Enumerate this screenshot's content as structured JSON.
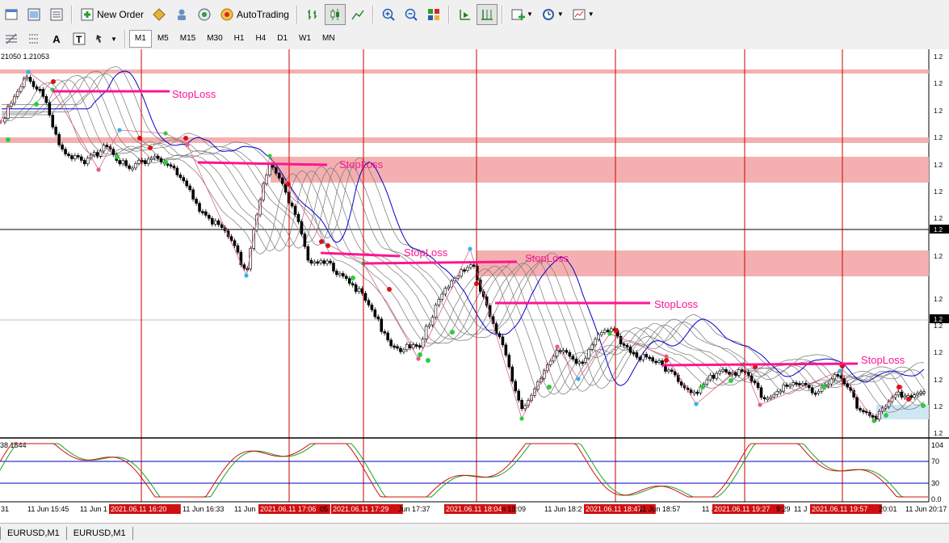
{
  "toolbar": {
    "new_order": "New Order",
    "autotrading": "AutoTrading"
  },
  "timeframes": [
    "M1",
    "M5",
    "M15",
    "M30",
    "H1",
    "H4",
    "D1",
    "W1",
    "MN"
  ],
  "active_timeframe": "M1",
  "chart": {
    "price_header": "21050 1.21053",
    "indicator_header": "38.1544",
    "right_labels": [
      "1.2",
      "1.2",
      "1.2",
      "1.2",
      "1.2",
      "1.2",
      "1.2",
      "1.2",
      "1.2",
      "1.2",
      "1.2",
      "1.2",
      "1.2",
      "1.2",
      "1.2"
    ],
    "current_price_label": "1.2",
    "indicator_levels": [
      "104",
      "70",
      "30",
      "0.0"
    ],
    "stoploss_label": "StopLoss",
    "time_axis": [
      {
        "text": "31",
        "highlight": false
      },
      {
        "text": "11 Jun 15:45",
        "highlight": false
      },
      {
        "text": "11 Jun 1",
        "highlight": false
      },
      {
        "text": "2021.06.11 16:20",
        "highlight": true
      },
      {
        "text": "11 Jun 16:33",
        "highlight": false
      },
      {
        "text": "11 Jun",
        "highlight": false
      },
      {
        "text": "2021.06.11 17:06",
        "highlight": true
      },
      {
        "text": "05",
        "highlight": false
      },
      {
        "text": "2021.06.11 17:29",
        "highlight": true
      },
      {
        "text": "Jun 17:37",
        "highlight": false
      },
      {
        "text": "2021.06.11 18:04",
        "highlight": true
      },
      {
        "text": "n 18:09",
        "highlight": false
      },
      {
        "text": "11 Jun 18:2",
        "highlight": false
      },
      {
        "text": "2021.06.11 18:47",
        "highlight": true
      },
      {
        "text": "11 Jun 18:57",
        "highlight": false
      },
      {
        "text": "11 J",
        "highlight": false
      },
      {
        "text": "2021.06.11 19:27",
        "highlight": true
      },
      {
        "text": "9:29",
        "highlight": false
      },
      {
        "text": "11 J",
        "highlight": false
      },
      {
        "text": "2021.06.11 19:57",
        "highlight": true
      },
      {
        "text": "20:01",
        "highlight": false
      },
      {
        "text": "11 Jun 20:17",
        "highlight": false
      }
    ]
  },
  "tabs": [
    "EURUSD,M1",
    "EURUSD,M1"
  ],
  "colors": {
    "stoploss": "#ff1493",
    "zone": "#f4b0b0",
    "vline": "#cc0000",
    "upper_band": "#0000cc",
    "candle": "#000000"
  }
}
